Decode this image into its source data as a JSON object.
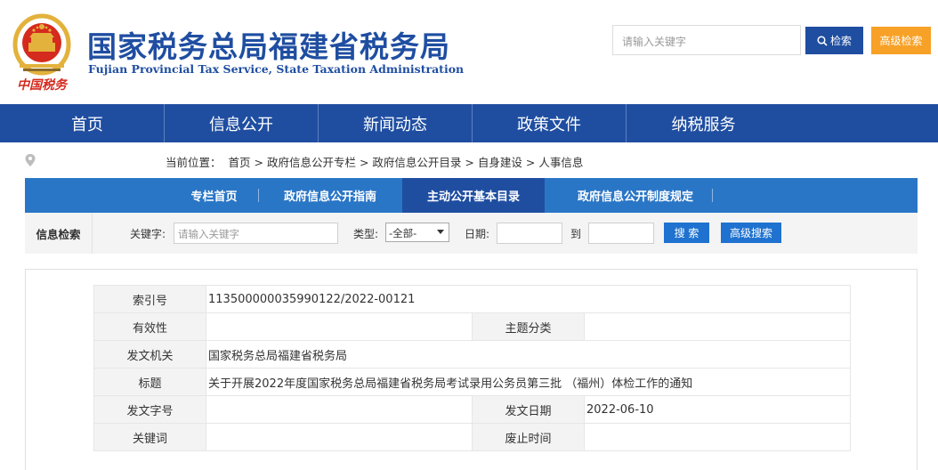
{
  "header": {
    "title": "国家税务总局福建省税务局",
    "subtitle": "Fujian Provincial Tax Service, State Taxation Administration",
    "emblem_text": "中国税务",
    "search_placeholder": "请输入关键字",
    "search_button": "检索",
    "advanced_button": "高级检索"
  },
  "nav": {
    "items": [
      "首页",
      "信息公开",
      "新闻动态",
      "政策文件",
      "纳税服务"
    ]
  },
  "breadcrumb": {
    "prefix": "当前位置：",
    "items": [
      "首页",
      "政府信息公开专栏",
      "政府信息公开目录",
      "自身建设",
      "人事信息"
    ],
    "separator": ">"
  },
  "subnav": {
    "items": [
      "专栏首页",
      "政府信息公开指南",
      "主动公开基本目录",
      "政府信息公开制度规定"
    ],
    "active": "主动公开基本目录"
  },
  "search_bar": {
    "title": "信息检索",
    "keyword_label": "关键字:",
    "keyword_placeholder": "请输入关键字",
    "type_label": "类型:",
    "type_selected": "-全部-",
    "date_label": "日期:",
    "date_to": "到",
    "search_button": "搜 索",
    "advanced_button": "高级搜索"
  },
  "info": {
    "index_label": "索引号",
    "index_value": "113500000035990122/2022-00121",
    "validity_label": "有效性",
    "validity_value": "",
    "category_label": "主题分类",
    "category_value": "",
    "issuer_label": "发文机关",
    "issuer_value": "国家税务总局福建省税务局",
    "title_label": "标题",
    "title_value": "关于开展2022年度国家税务总局福建省税务局考试录用公务员第三批 （福州）体检工作的通知",
    "docno_label": "发文字号",
    "docno_value": "",
    "date_label": "发文日期",
    "date_value": "2022-06-10",
    "keywords_label": "关键词",
    "keywords_value": "",
    "expiry_label": "废止时间",
    "expiry_value": ""
  },
  "colors": {
    "brand_blue": "#1f4ea1",
    "subnav_blue": "#2a76c6",
    "button_blue": "#1f72cf",
    "orange": "#f7a126",
    "emblem_red": "#d52a1e",
    "emblem_gold": "#e3b23c"
  }
}
